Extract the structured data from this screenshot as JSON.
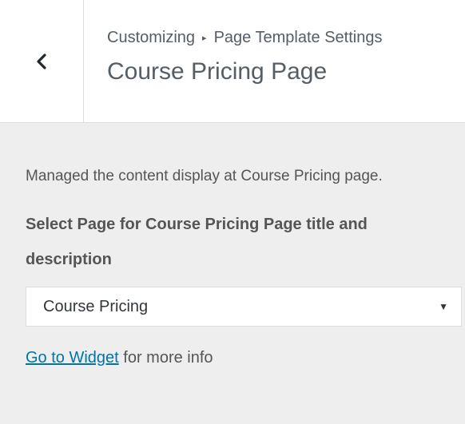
{
  "header": {
    "back_icon": "chevron-left-icon",
    "breadcrumb": {
      "root": "Customizing",
      "separator": "▸",
      "current": "Page Template Settings"
    },
    "title": "Course Pricing Page"
  },
  "section": {
    "description": "Managed the content display at Course Pricing page.",
    "control_label": "Select Page for Course Pricing Page title and description",
    "select": {
      "value": "Course Pricing",
      "arrow_icon": "triangle-down-icon"
    },
    "info": {
      "link_text": "Go to Widget",
      "suffix": " for more info"
    }
  },
  "colors": {
    "panel_bg": "#eeeeee",
    "header_bg": "#ffffff",
    "link": "#0073aa"
  }
}
